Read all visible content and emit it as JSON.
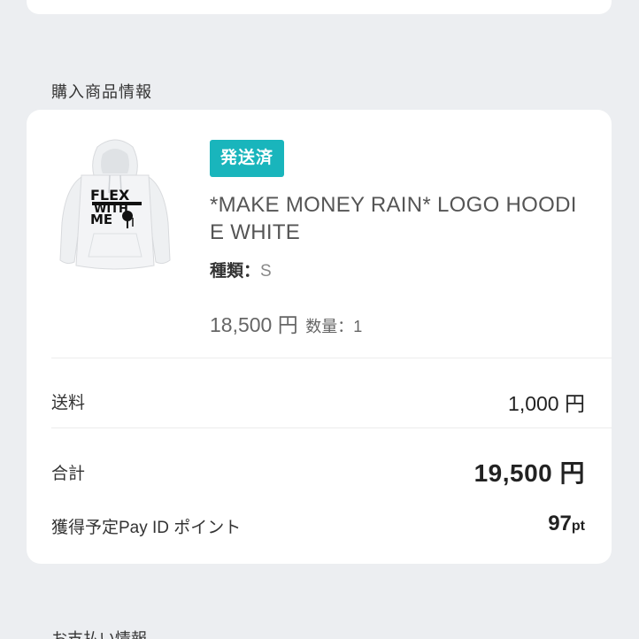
{
  "purchased_section": {
    "heading": "購入商品情報",
    "product": {
      "status_badge": "発送済",
      "name": "*MAKE MONEY RAIN* LOGO HOODIE WHITE",
      "variant_label": "種類：",
      "variant_value": "S",
      "price": "18,500 円",
      "quantity": "数量：1",
      "image_print_text": [
        "FLEX",
        "WITH",
        "ME"
      ],
      "image_alt": "hoodie-image"
    },
    "shipping_label": "送料",
    "shipping_value": "1,000 円",
    "total_label": "合計",
    "total_value": "19,500 円",
    "points_label": "獲得予定Pay ID ポイント",
    "points_value": "97",
    "points_unit": "pt"
  },
  "next_section": {
    "heading": "お支払い情報"
  },
  "colors": {
    "background": "#eceef1",
    "card": "#ffffff",
    "badge": "#19b5bc"
  }
}
